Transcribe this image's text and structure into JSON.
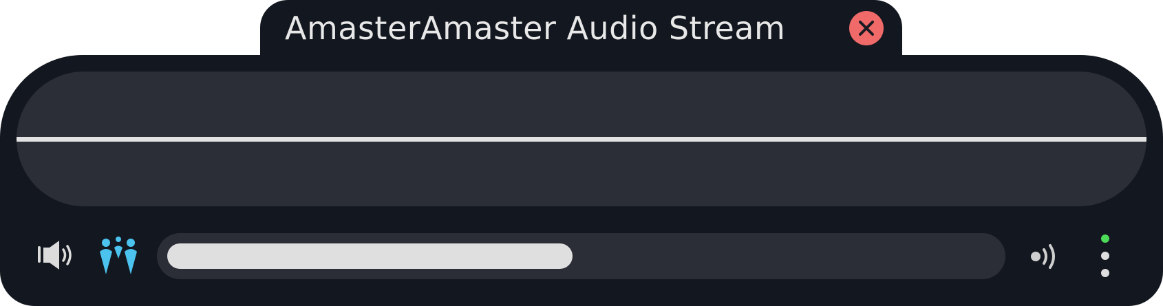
{
  "window": {
    "title": "AmasterAmaster Audio Stream"
  },
  "icons": {
    "close": "close-icon",
    "volume": "speaker-volume-icon",
    "listeners": "listeners-people-icon",
    "broadcast": "broadcast-signal-icon",
    "menu": "vertical-dots-menu-icon"
  },
  "playback": {
    "progress": 0.49
  },
  "status": {
    "live_indicator": "online"
  },
  "colors": {
    "background": "#13171f",
    "panel": "#2b2e37",
    "text": "#e8e8e8",
    "close": "#f06a6a",
    "accent": "#4cc3ee",
    "online": "#4ddb5a",
    "progress_fill": "#dfdfdf"
  }
}
